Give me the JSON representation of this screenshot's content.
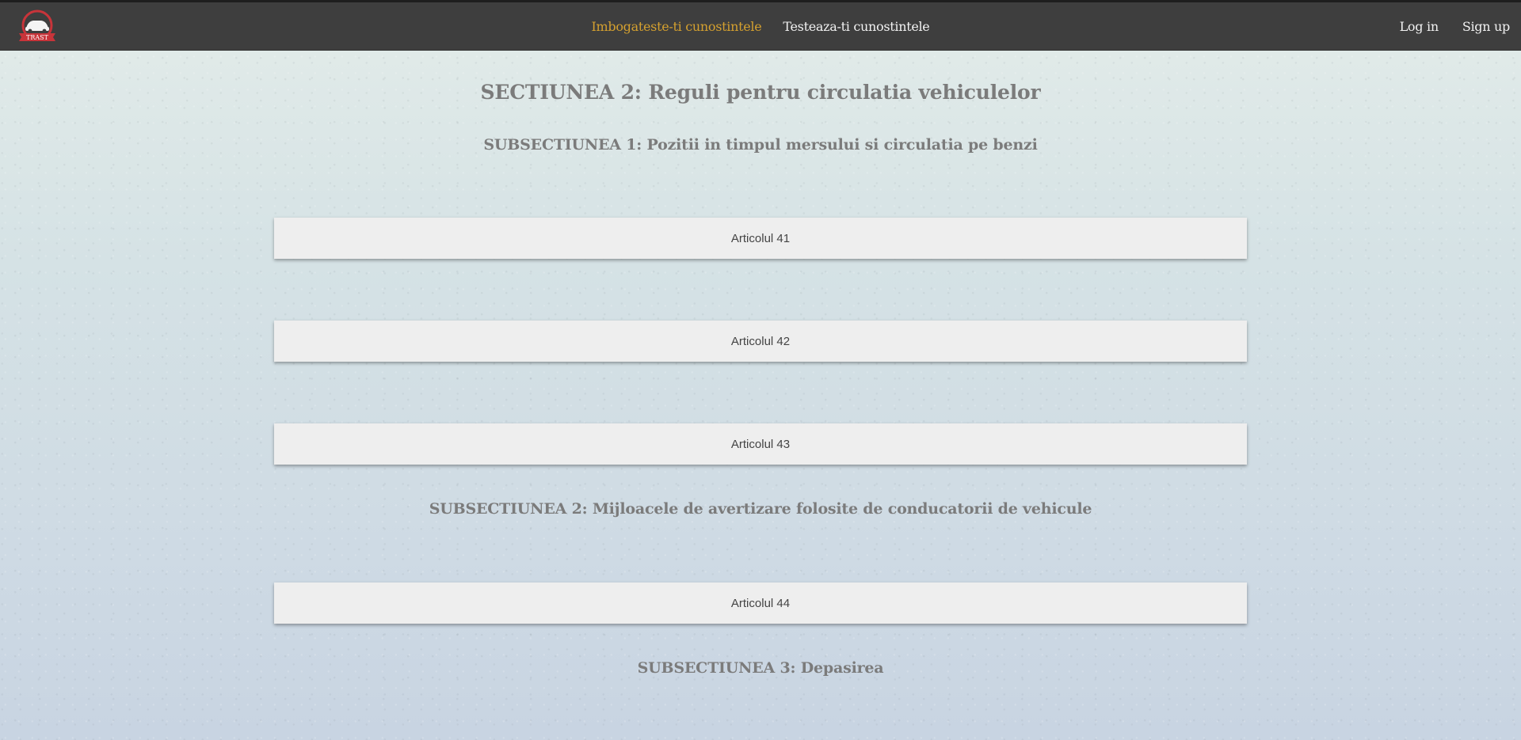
{
  "header": {
    "logo_icon": "car-logo-icon",
    "logo_text": "TRAST",
    "nav": [
      {
        "label": "Imbogateste-ti cunostintele",
        "active": true
      },
      {
        "label": "Testeaza-ti cunostintele",
        "active": false
      }
    ],
    "auth": {
      "login_label": "Log in",
      "signup_label": "Sign up"
    }
  },
  "colors": {
    "navbar_bg": "#3e3e3e",
    "active_link": "#d4a02f",
    "heading": "#7b7b7b",
    "card_bg": "#eeeeee"
  },
  "main": {
    "section_title": "SECTIUNEA 2: Reguli pentru circulatia vehiculelor",
    "subsections": [
      {
        "title": "SUBSECTIUNEA 1: Pozitii in timpul mersului si circulatia pe benzi",
        "articles": [
          "Articolul 41",
          "Articolul 42",
          "Articolul 43"
        ]
      },
      {
        "title": "SUBSECTIUNEA 2: Mijloacele de avertizare folosite de conducatorii de vehicule",
        "articles": [
          "Articolul 44"
        ]
      },
      {
        "title": "SUBSECTIUNEA 3: Depasirea",
        "articles": []
      }
    ]
  }
}
